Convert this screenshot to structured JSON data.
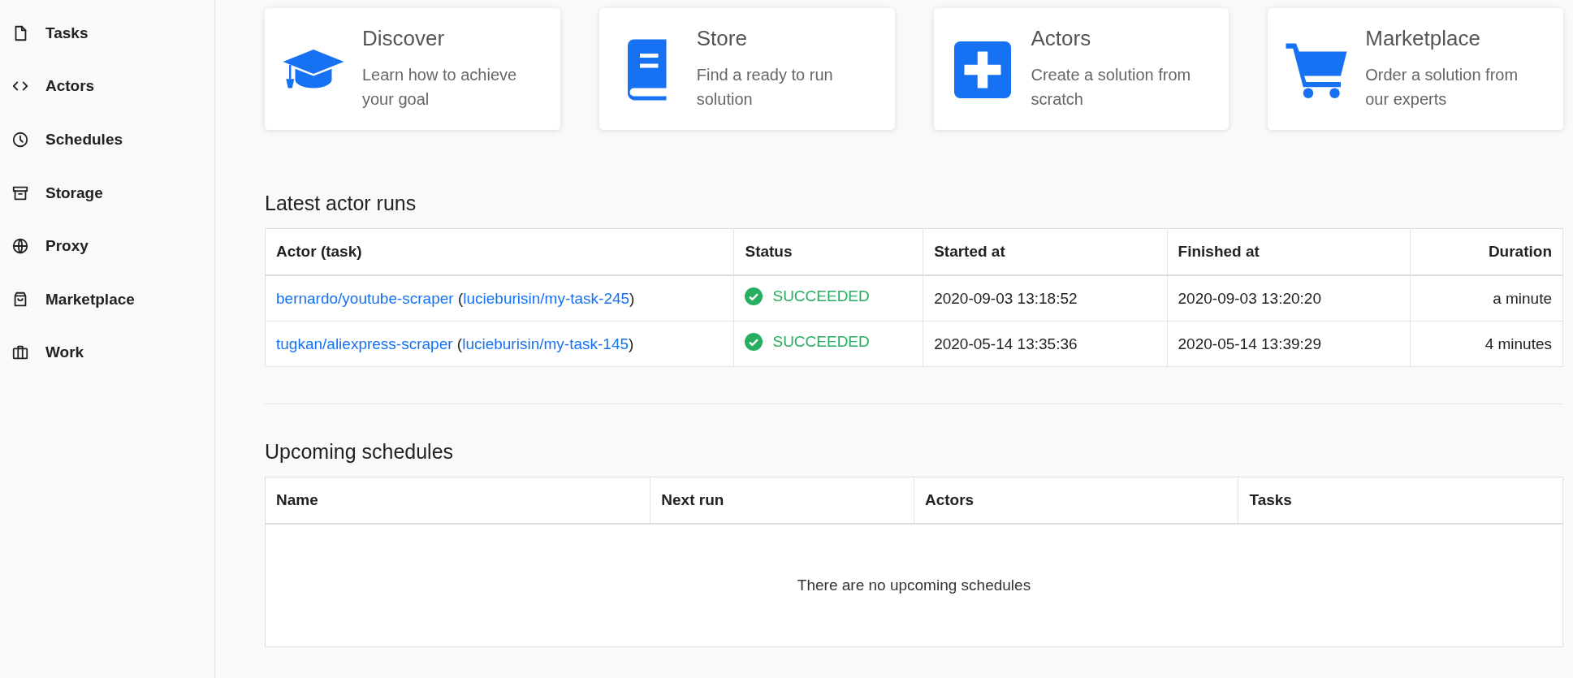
{
  "sidebar": {
    "items": [
      {
        "label": "Tasks",
        "selected": false
      },
      {
        "label": "Actors",
        "selected": false
      },
      {
        "label": "Schedules",
        "selected": false
      },
      {
        "label": "Storage",
        "selected": false
      },
      {
        "label": "Proxy",
        "selected": false
      },
      {
        "label": "Marketplace",
        "selected": false
      },
      {
        "label": "Work",
        "selected": false
      }
    ]
  },
  "cards": [
    {
      "title": "Discover",
      "description": "Learn how to achieve your goal"
    },
    {
      "title": "Store",
      "description": "Find a ready to run solution"
    },
    {
      "title": "Actors",
      "description": "Create a solution from scratch"
    },
    {
      "title": "Marketplace",
      "description": "Order a solution from our experts"
    }
  ],
  "latest_runs": {
    "title": "Latest actor runs",
    "columns": [
      "Actor (task)",
      "Status",
      "Started at",
      "Finished at",
      "Duration"
    ],
    "rows": [
      {
        "actor": "bernardo/youtube-scraper",
        "open": "(",
        "task": "lucieburisin/my-task-245",
        "close": ")",
        "status": "SUCCEEDED",
        "started": "2020-09-03 13:18:52",
        "finished": "2020-09-03 13:20:20",
        "duration": "a minute"
      },
      {
        "actor": "tugkan/aliexpress-scraper",
        "open": "(",
        "task": "lucieburisin/my-task-145",
        "close": ")",
        "status": "SUCCEEDED",
        "started": "2020-05-14 13:35:36",
        "finished": "2020-05-14 13:39:29",
        "duration": "4 minutes"
      }
    ]
  },
  "upcoming_schedules": {
    "title": "Upcoming schedules",
    "columns": [
      "Name",
      "Next run",
      "Actors",
      "Tasks"
    ],
    "empty_message": "There are no upcoming schedules"
  }
}
